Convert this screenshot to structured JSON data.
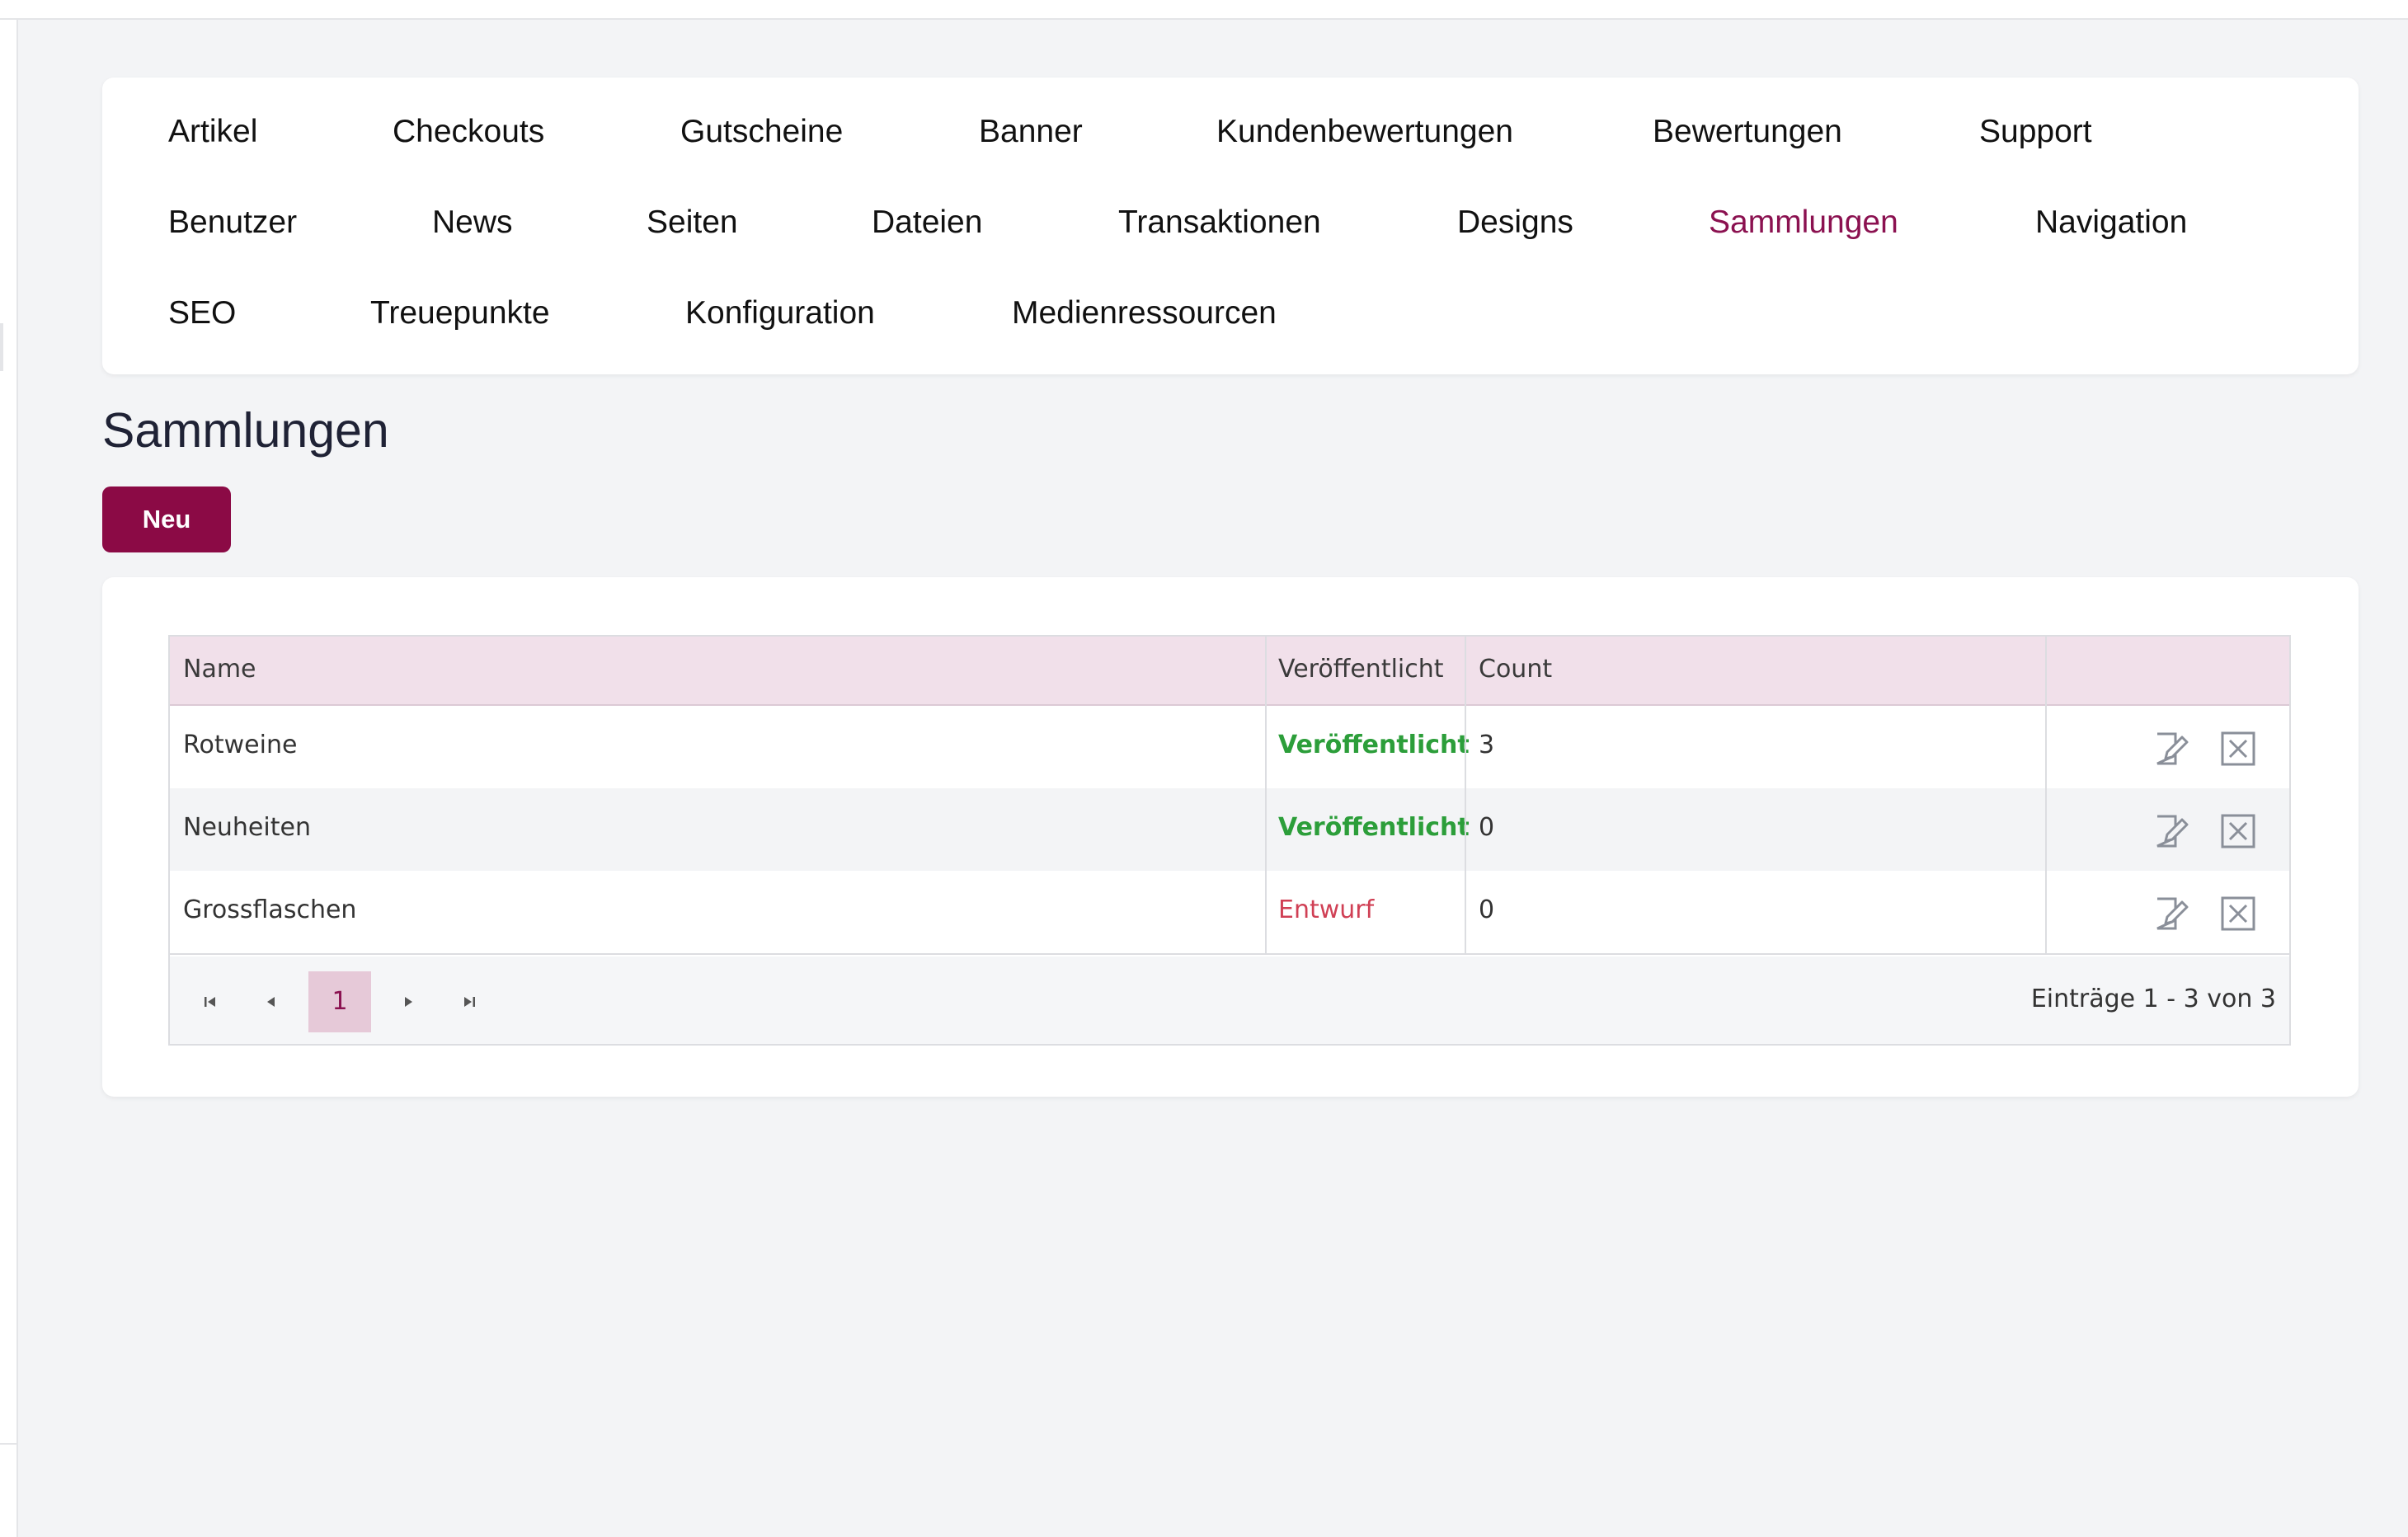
{
  "nav": {
    "items": [
      {
        "label": "Artikel",
        "active": false
      },
      {
        "label": "Checkouts",
        "active": false
      },
      {
        "label": "Gutscheine",
        "active": false
      },
      {
        "label": "Banner",
        "active": false
      },
      {
        "label": "Kundenbewertungen",
        "active": false
      },
      {
        "label": "Bewertungen",
        "active": false
      },
      {
        "label": "Support",
        "active": false
      },
      {
        "label": "Benutzer",
        "active": false
      },
      {
        "label": "News",
        "active": false
      },
      {
        "label": "Seiten",
        "active": false
      },
      {
        "label": "Dateien",
        "active": false
      },
      {
        "label": "Transaktionen",
        "active": false
      },
      {
        "label": "Designs",
        "active": false
      },
      {
        "label": "Sammlungen",
        "active": true
      },
      {
        "label": "Navigation",
        "active": false
      },
      {
        "label": "SEO",
        "active": false
      },
      {
        "label": "Treuepunkte",
        "active": false
      },
      {
        "label": "Konfiguration",
        "active": false
      },
      {
        "label": "Medienressourcen",
        "active": false
      }
    ]
  },
  "page": {
    "title": "Sammlungen",
    "new_button": "Neu"
  },
  "table": {
    "columns": [
      "Name",
      "Veröffentlicht",
      "Count",
      ""
    ],
    "rows": [
      {
        "name": "Rotweine",
        "status": "Veröffentlicht",
        "status_type": "published",
        "count": "3"
      },
      {
        "name": "Neuheiten",
        "status": "Veröffentlicht",
        "status_type": "published",
        "count": "0"
      },
      {
        "name": "Grossflaschen",
        "status": "Entwurf",
        "status_type": "draft",
        "count": "0"
      }
    ],
    "row_actions": [
      "edit-icon",
      "delete-icon"
    ]
  },
  "pager": {
    "current_page": "1",
    "info": "Einträge 1 - 3 von 3"
  },
  "colors": {
    "accent": "#8b0a45",
    "active_nav": "#8b1150",
    "published": "#2c9e3a",
    "draft": "#d04055",
    "header_bg": "#f1e0ea",
    "page_bg": "#f3f4f6"
  }
}
